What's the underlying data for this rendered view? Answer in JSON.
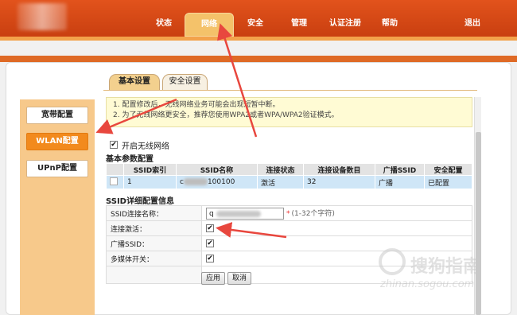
{
  "nav": {
    "items": [
      "状态",
      "网络",
      "安全",
      "管理",
      "认证注册",
      "帮助"
    ],
    "logout": "退出"
  },
  "subtabs": [
    "基本设置",
    "安全设置"
  ],
  "sidebar": {
    "items": [
      "宽带配置",
      "WLAN配置",
      "UPnP配置"
    ]
  },
  "notice": {
    "line1": "1. 配置修改后，无线网络业务可能会出现短暂中断。",
    "line2": "2. 为了无线网络更安全，推荐您使用WPA2或者WPA/WPA2验证模式。"
  },
  "enable_wireless": {
    "label": "开启无线网络",
    "checked": true
  },
  "basic_params": {
    "title": "基本参数配置",
    "columns": [
      "SSID索引",
      "SSID名称",
      "连接状态",
      "连接设备数目",
      "广播SSID",
      "安全配置"
    ],
    "row": {
      "index": "1",
      "name_prefix": "c",
      "name_suffix": "100100",
      "status": "激活",
      "devices": "32",
      "broadcast": "广播",
      "security": "已配置"
    }
  },
  "ssid_detail": {
    "title": "SSID详细配置信息",
    "name_label": "SSID连接名称：",
    "name_value_prefix": "q",
    "name_required": "*",
    "name_hint": "(1-32个字符)",
    "connect_active_label": "连接激活：",
    "broadcast_label": "广播SSID：",
    "multimedia_label": "多媒体开关："
  },
  "buttons": {
    "apply": "应用",
    "cancel": "取消"
  },
  "watermark": {
    "text": "搜狗指南",
    "url": "zhinan.sogou.com"
  },
  "colors": {
    "nav": "#d9491a",
    "sidebar": "#f7c98b",
    "active_side": "#f28a1d",
    "arrow": "#e8473e"
  }
}
